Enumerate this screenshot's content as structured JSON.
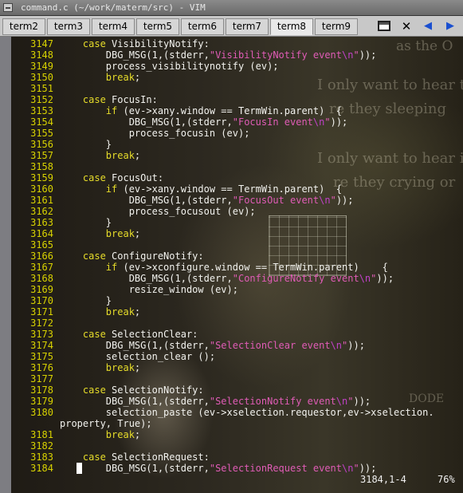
{
  "window": {
    "title": "command.c (~/work/materm/src) - VIM"
  },
  "tabs": [
    {
      "label": "term2",
      "active": false
    },
    {
      "label": "term3",
      "active": false
    },
    {
      "label": "term4",
      "active": false
    },
    {
      "label": "term5",
      "active": false
    },
    {
      "label": "term6",
      "active": false
    },
    {
      "label": "term7",
      "active": false
    },
    {
      "label": "term8",
      "active": true
    },
    {
      "label": "term9",
      "active": false
    }
  ],
  "tab_controls": {
    "window_icon": "window-icon",
    "close_glyph": "✕",
    "prev_glyph": "◀",
    "next_glyph": "▶"
  },
  "background_text": [
    "as the O",
    "I only want to hear t",
    "re they sleeping",
    "I only want to hear it",
    "re they crying or",
    "DODE"
  ],
  "editor": {
    "lines": [
      {
        "n": "3147",
        "segs": [
          [
            "    ",
            ""
          ],
          [
            "case",
            "kw"
          ],
          [
            " VisibilityNotify:",
            ""
          ]
        ]
      },
      {
        "n": "3148",
        "segs": [
          [
            "        DBG_MSG(1,(stderr,",
            ""
          ],
          [
            "\"VisibilityNotify event",
            "str"
          ],
          [
            "\\n",
            "esc"
          ],
          [
            "\"",
            "str"
          ],
          [
            "));",
            ""
          ]
        ]
      },
      {
        "n": "3149",
        "segs": [
          [
            "        process_visibilitynotify (ev);",
            ""
          ]
        ]
      },
      {
        "n": "3150",
        "segs": [
          [
            "        ",
            ""
          ],
          [
            "break",
            "kw"
          ],
          [
            ";",
            ""
          ]
        ]
      },
      {
        "n": "3151",
        "segs": []
      },
      {
        "n": "3152",
        "segs": [
          [
            "    ",
            ""
          ],
          [
            "case",
            "kw"
          ],
          [
            " FocusIn:",
            ""
          ]
        ]
      },
      {
        "n": "3153",
        "segs": [
          [
            "        ",
            ""
          ],
          [
            "if",
            "kw"
          ],
          [
            " (ev->xany.window == TermWin.parent)  {",
            ""
          ]
        ]
      },
      {
        "n": "3154",
        "segs": [
          [
            "            DBG_MSG(1,(stderr,",
            ""
          ],
          [
            "\"FocusIn event",
            "str"
          ],
          [
            "\\n",
            "esc"
          ],
          [
            "\"",
            "str"
          ],
          [
            "));",
            ""
          ]
        ]
      },
      {
        "n": "3155",
        "segs": [
          [
            "            process_focusin (ev);",
            ""
          ]
        ]
      },
      {
        "n": "3156",
        "segs": [
          [
            "        }",
            ""
          ]
        ]
      },
      {
        "n": "3157",
        "segs": [
          [
            "        ",
            ""
          ],
          [
            "break",
            "kw"
          ],
          [
            ";",
            ""
          ]
        ]
      },
      {
        "n": "3158",
        "segs": []
      },
      {
        "n": "3159",
        "segs": [
          [
            "    ",
            ""
          ],
          [
            "case",
            "kw"
          ],
          [
            " FocusOut:",
            ""
          ]
        ]
      },
      {
        "n": "3160",
        "segs": [
          [
            "        ",
            ""
          ],
          [
            "if",
            "kw"
          ],
          [
            " (ev->xany.window == TermWin.parent)  {",
            ""
          ]
        ]
      },
      {
        "n": "3161",
        "segs": [
          [
            "            DBG_MSG(1,(stderr,",
            ""
          ],
          [
            "\"FocusOut event",
            "str"
          ],
          [
            "\\n",
            "esc"
          ],
          [
            "\"",
            "str"
          ],
          [
            "));",
            ""
          ]
        ]
      },
      {
        "n": "3162",
        "segs": [
          [
            "            process_focusout (ev);",
            ""
          ]
        ]
      },
      {
        "n": "3163",
        "segs": [
          [
            "        }",
            ""
          ]
        ]
      },
      {
        "n": "3164",
        "segs": [
          [
            "        ",
            ""
          ],
          [
            "break",
            "kw"
          ],
          [
            ";",
            ""
          ]
        ]
      },
      {
        "n": "3165",
        "segs": []
      },
      {
        "n": "3166",
        "segs": [
          [
            "    ",
            ""
          ],
          [
            "case",
            "kw"
          ],
          [
            " ConfigureNotify:",
            ""
          ]
        ]
      },
      {
        "n": "3167",
        "segs": [
          [
            "        ",
            ""
          ],
          [
            "if",
            "kw"
          ],
          [
            " (ev->xconfigure.window == TermWin.parent)    {",
            ""
          ]
        ]
      },
      {
        "n": "3168",
        "segs": [
          [
            "            DBG_MSG(1,(stderr,",
            ""
          ],
          [
            "\"ConfigureNotify event",
            "str"
          ],
          [
            "\\n",
            "esc"
          ],
          [
            "\"",
            "str"
          ],
          [
            "));",
            ""
          ]
        ]
      },
      {
        "n": "3169",
        "segs": [
          [
            "            resize_window (ev);",
            ""
          ]
        ]
      },
      {
        "n": "3170",
        "segs": [
          [
            "        }",
            ""
          ]
        ]
      },
      {
        "n": "3171",
        "segs": [
          [
            "        ",
            ""
          ],
          [
            "break",
            "kw"
          ],
          [
            ";",
            ""
          ]
        ]
      },
      {
        "n": "3172",
        "segs": []
      },
      {
        "n": "3173",
        "segs": [
          [
            "    ",
            ""
          ],
          [
            "case",
            "kw"
          ],
          [
            " SelectionClear:",
            ""
          ]
        ]
      },
      {
        "n": "3174",
        "segs": [
          [
            "        DBG_MSG(1,(stderr,",
            ""
          ],
          [
            "\"SelectionClear event",
            "str"
          ],
          [
            "\\n",
            "esc"
          ],
          [
            "\"",
            "str"
          ],
          [
            "));",
            ""
          ]
        ]
      },
      {
        "n": "3175",
        "segs": [
          [
            "        selection_clear ();",
            ""
          ]
        ]
      },
      {
        "n": "3176",
        "segs": [
          [
            "        ",
            ""
          ],
          [
            "break",
            "kw"
          ],
          [
            ";",
            ""
          ]
        ]
      },
      {
        "n": "3177",
        "segs": []
      },
      {
        "n": "3178",
        "segs": [
          [
            "    ",
            ""
          ],
          [
            "case",
            "kw"
          ],
          [
            " SelectionNotify:",
            ""
          ]
        ]
      },
      {
        "n": "3179",
        "segs": [
          [
            "        DBG_MSG(1,(stderr,",
            ""
          ],
          [
            "\"SelectionNotify event",
            "str"
          ],
          [
            "\\n",
            "esc"
          ],
          [
            "\"",
            "str"
          ],
          [
            "));",
            ""
          ]
        ]
      },
      {
        "n": "3180",
        "segs": [
          [
            "        selection_paste (ev->xselection.requestor,ev->xselection.",
            ""
          ]
        ]
      },
      {
        "n": "",
        "segs": [
          [
            "property, True);",
            ""
          ]
        ],
        "wrap": true
      },
      {
        "n": "3181",
        "segs": [
          [
            "        ",
            ""
          ],
          [
            "break",
            "kw"
          ],
          [
            ";",
            ""
          ]
        ]
      },
      {
        "n": "3182",
        "segs": []
      },
      {
        "n": "3183",
        "segs": [
          [
            "    ",
            ""
          ],
          [
            "case",
            "kw"
          ],
          [
            " SelectionRequest:",
            ""
          ]
        ]
      },
      {
        "n": "3184",
        "segs": [
          [
            "        DBG_MSG(1,(stderr,",
            ""
          ],
          [
            "\"SelectionRequest event",
            "str"
          ],
          [
            "\\n",
            "esc"
          ],
          [
            "\"",
            "str"
          ],
          [
            "));",
            ""
          ]
        ],
        "cursor": true
      }
    ],
    "status_position": "3184,1-4",
    "status_percent": "76%"
  }
}
